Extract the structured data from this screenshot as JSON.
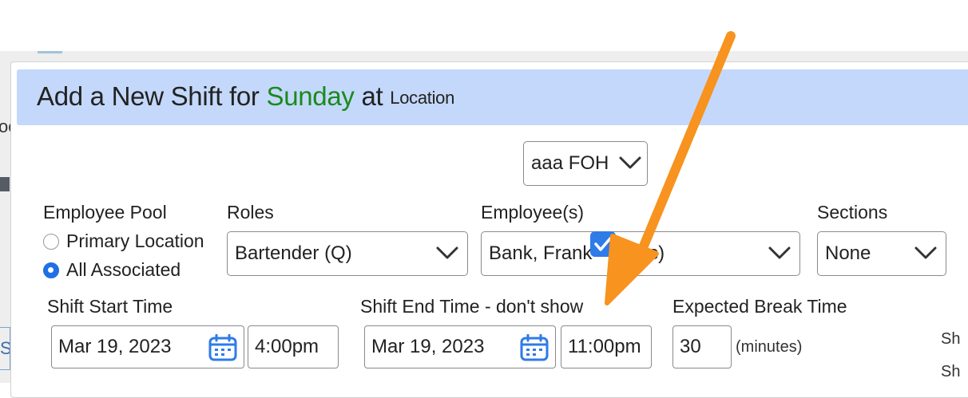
{
  "modal": {
    "title_prefix": "Add a New Shift for",
    "day": "Sunday",
    "at": "at",
    "location_label": "Location",
    "location_value": "aaa FOH"
  },
  "employee_pool": {
    "label": "Employee Pool",
    "options": [
      "Primary Location",
      "All Associated"
    ],
    "selected": "All Associated"
  },
  "roles": {
    "label": "Roles",
    "value": "Bartender (Q)"
  },
  "employees": {
    "label": "Employee(s)",
    "value": "Bank, Frank - (0 hrs)"
  },
  "sections": {
    "label": "Sections",
    "value": "None"
  },
  "shift_start": {
    "label": "Shift Start Time",
    "date": "Mar 19, 2023",
    "time": "4:00pm"
  },
  "shift_end": {
    "label": "Shift End Time - don't show",
    "date": "Mar 19, 2023",
    "time": "11:00pm",
    "dont_show_checked": true
  },
  "break": {
    "label": "Expected Break Time",
    "value": "30",
    "unit": "(minutes)"
  },
  "background": {
    "left_fragment_top": "oc",
    "left_fragment_bottom": "S",
    "right_fragment_1": "Sh",
    "right_fragment_2": "Sh"
  },
  "colors": {
    "accent": "#2f7be8",
    "day": "#1a8a1a",
    "header": "#c4d8fb",
    "annotation_arrow": "#f7931e"
  },
  "icons": {
    "select_chevron": "chevron-down-icon",
    "date_picker": "calendar-icon",
    "check": "checkmark-icon",
    "annotation": "arrow-icon"
  }
}
